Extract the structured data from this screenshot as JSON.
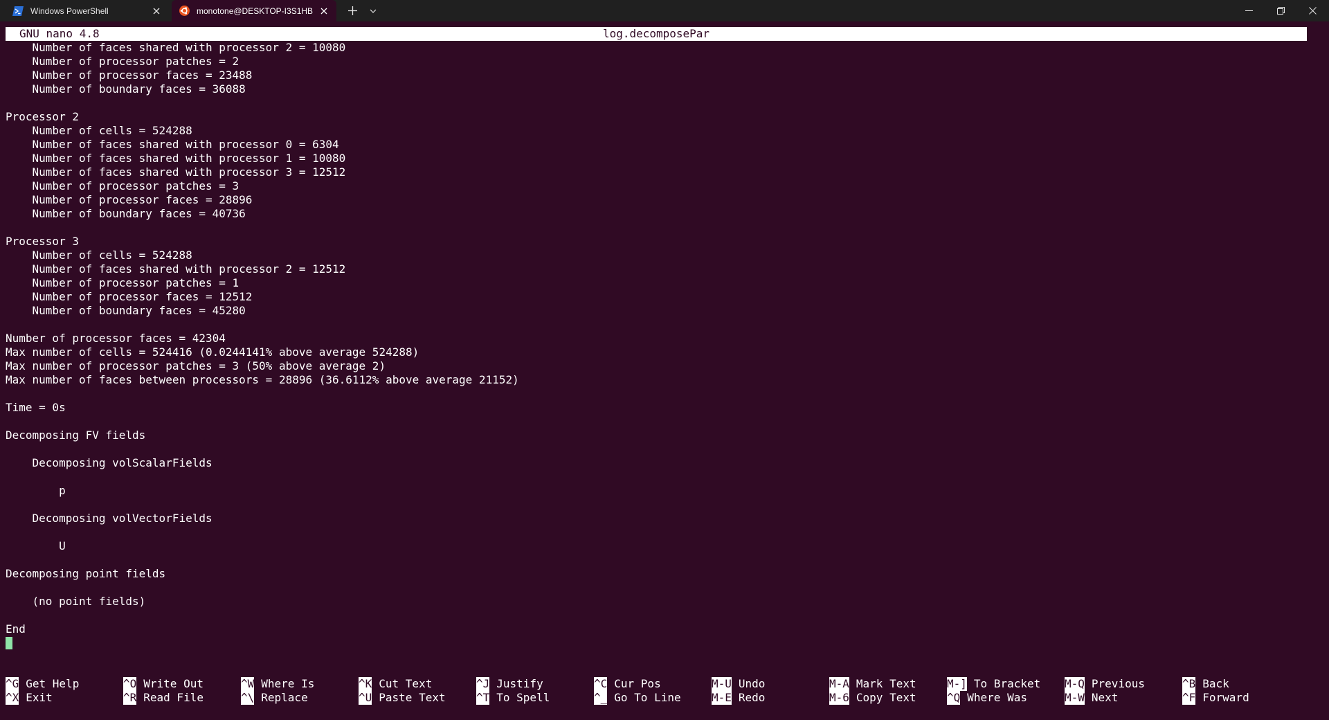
{
  "tabs": [
    {
      "title": "Windows PowerShell",
      "icon": "powershell-icon"
    },
    {
      "title": "monotone@DESKTOP-I3S1HB",
      "icon": "ubuntu-icon"
    }
  ],
  "header": {
    "version": "GNU nano 4.8",
    "filename": "log.decomposePar"
  },
  "lines": [
    "    Number of faces shared with processor 2 = 10080",
    "    Number of processor patches = 2",
    "    Number of processor faces = 23488",
    "    Number of boundary faces = 36088",
    "",
    "Processor 2",
    "    Number of cells = 524288",
    "    Number of faces shared with processor 0 = 6304",
    "    Number of faces shared with processor 1 = 10080",
    "    Number of faces shared with processor 3 = 12512",
    "    Number of processor patches = 3",
    "    Number of processor faces = 28896",
    "    Number of boundary faces = 40736",
    "",
    "Processor 3",
    "    Number of cells = 524288",
    "    Number of faces shared with processor 2 = 12512",
    "    Number of processor patches = 1",
    "    Number of processor faces = 12512",
    "    Number of boundary faces = 45280",
    "",
    "Number of processor faces = 42304",
    "Max number of cells = 524416 (0.0244141% above average 524288)",
    "Max number of processor patches = 3 (50% above average 2)",
    "Max number of faces between processors = 28896 (36.6112% above average 21152)",
    "",
    "Time = 0s",
    "",
    "Decomposing FV fields",
    "",
    "    Decomposing volScalarFields",
    "",
    "        p",
    "",
    "    Decomposing volVectorFields",
    "",
    "        U",
    "",
    "Decomposing point fields",
    "",
    "    (no point fields)",
    "",
    "End",
    ""
  ],
  "shortcuts": [
    {
      "key": "^G",
      "label": "Get Help"
    },
    {
      "key": "^X",
      "label": "Exit"
    },
    {
      "key": "^O",
      "label": "Write Out"
    },
    {
      "key": "^R",
      "label": "Read File"
    },
    {
      "key": "^W",
      "label": "Where Is"
    },
    {
      "key": "^\\",
      "label": "Replace"
    },
    {
      "key": "^K",
      "label": "Cut Text"
    },
    {
      "key": "^U",
      "label": "Paste Text"
    },
    {
      "key": "^J",
      "label": "Justify"
    },
    {
      "key": "^T",
      "label": "To Spell"
    },
    {
      "key": "^C",
      "label": "Cur Pos"
    },
    {
      "key": "^_",
      "label": "Go To Line"
    },
    {
      "key": "M-U",
      "label": "Undo"
    },
    {
      "key": "M-E",
      "label": "Redo"
    },
    {
      "key": "M-A",
      "label": "Mark Text"
    },
    {
      "key": "M-6",
      "label": "Copy Text"
    },
    {
      "key": "M-]",
      "label": "To Bracket"
    },
    {
      "key": "^Q",
      "label": "Where Was"
    },
    {
      "key": "M-Q",
      "label": "Previous"
    },
    {
      "key": "M-W",
      "label": "Next"
    },
    {
      "key": "^B",
      "label": "Back"
    },
    {
      "key": "^F",
      "label": "Forward"
    }
  ],
  "colors": {
    "terminal_bg": "#300a24",
    "titlebar_bg": "#202020",
    "cursor": "#8fe3a8",
    "powershell_blue": "#2a6fd6",
    "ubuntu_orange": "#e95420"
  }
}
